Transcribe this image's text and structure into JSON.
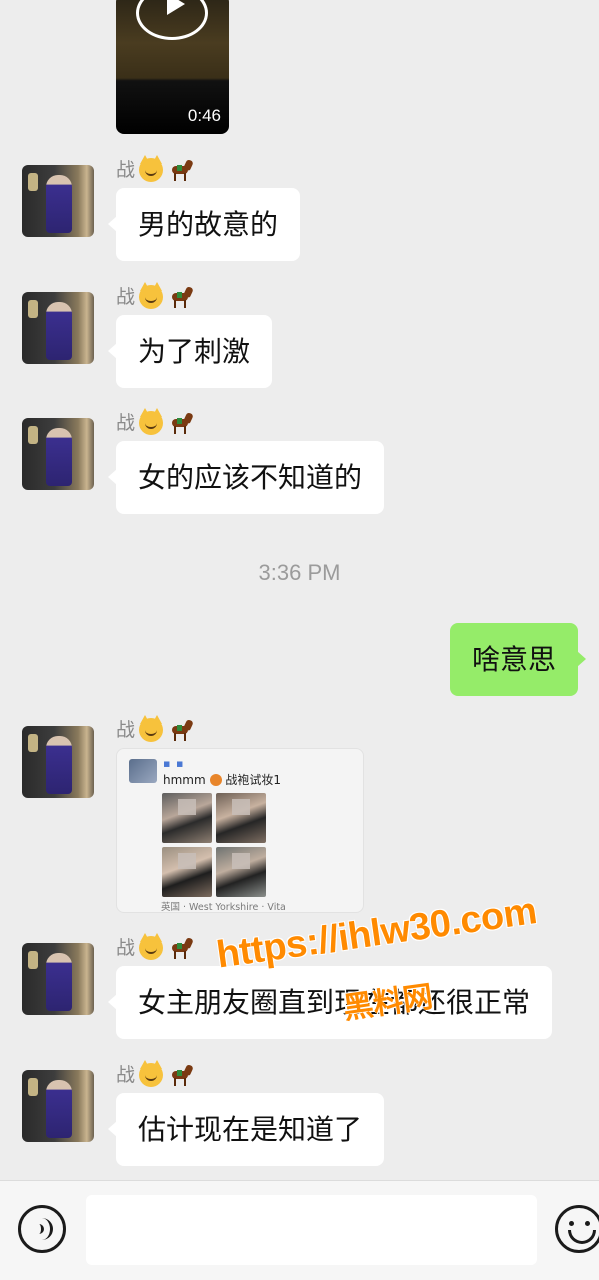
{
  "video": {
    "duration": "0:46"
  },
  "sender_name": "战",
  "messages": [
    {
      "text": "男的故意的"
    },
    {
      "text": "为了刺激"
    },
    {
      "text": "女的应该不知道的"
    },
    {
      "text": "啥意思"
    },
    {
      "text": "女主朋友圈直到现在都还很正常"
    },
    {
      "text": "估计现在是知道了"
    }
  ],
  "timestamp": "3:36 PM",
  "card": {
    "header_marks": "▪ ▪",
    "text_before": "hmmm",
    "text_after": "战袍试妆1",
    "location": "英国 · West Yorkshire · Vita"
  },
  "watermark": {
    "url": "https://ihlw30.com",
    "site": "黑料网"
  },
  "input": {
    "placeholder": ""
  },
  "icons": {
    "voice": "voice-icon",
    "emoji": "emoji-icon",
    "play": "play-icon"
  }
}
